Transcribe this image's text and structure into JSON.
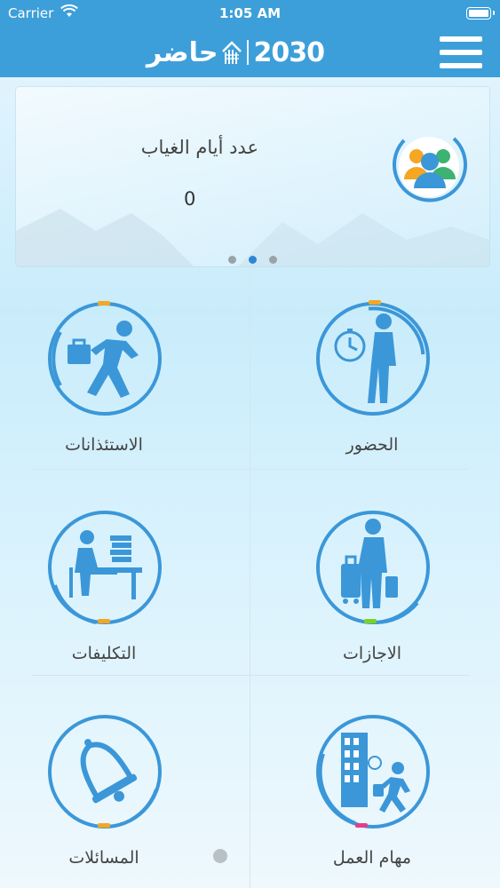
{
  "status_bar": {
    "carrier": "Carrier",
    "time": "1:05 AM"
  },
  "header": {
    "brand": "حاضر",
    "vision": "2030",
    "menu_icon": "hamburger-menu-icon"
  },
  "summary_card": {
    "title": "عدد أيام الغياب",
    "value": "0",
    "icon": "team-users-icon",
    "pages": 3,
    "active_page": 2
  },
  "menu_tiles": [
    {
      "label": "الحضور",
      "icon": "attendance-walking-clock-icon",
      "accent": "#f5a623"
    },
    {
      "label": "الاستئذانات",
      "icon": "leaving-with-briefcase-icon",
      "accent": "#f5a623"
    },
    {
      "label": "الاجازات",
      "icon": "vacation-luggage-icon",
      "accent": "#7ed321"
    },
    {
      "label": "التكليفات",
      "icon": "assignment-desk-icon",
      "accent": "#f5a623"
    },
    {
      "label": "مهام العمل",
      "icon": "business-trip-building-icon",
      "accent": "#e0408b"
    },
    {
      "label": "المسائلات",
      "icon": "bell-notification-icon",
      "accent": "#f5a623"
    }
  ],
  "colors": {
    "primary": "#3d9fd9",
    "icon_blue": "#3b97d8"
  }
}
